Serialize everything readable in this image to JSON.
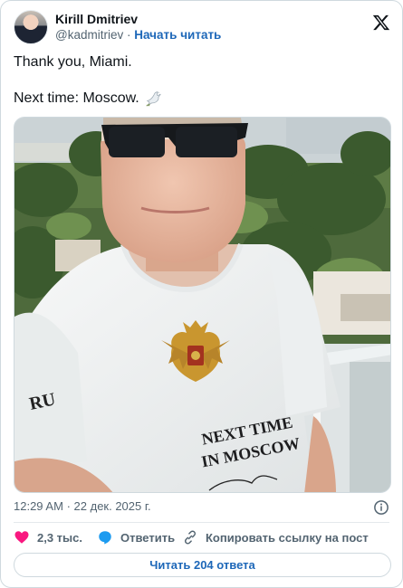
{
  "author": {
    "name": "Kirill Dmitriev",
    "handle": "@kadmitriev",
    "separator": "·",
    "follow_label": "Начать читать"
  },
  "tweet": {
    "line1": "Thank you, Miami.",
    "line2": "Next time: Moscow."
  },
  "photo": {
    "shirt_text_line1": "NEXT TIME",
    "shirt_text_line2": "IN MOSCOW",
    "sleeve_text": "RU"
  },
  "meta": {
    "time": "12:29 AM",
    "separator": "·",
    "date": "22 дек. 2025 г."
  },
  "actions": {
    "likes": "2,3 тыс.",
    "reply": "Ответить",
    "copy_link": "Копировать ссылку на пост"
  },
  "read_replies": "Читать 204 ответа",
  "colors": {
    "like": "#f91880",
    "reply": "#1d9bf0",
    "link": "#1d67b8",
    "secondary_text": "#536471"
  },
  "icons": [
    "x-logo-icon",
    "dove-icon",
    "info-icon",
    "heart-icon",
    "reply-bubble-icon",
    "link-icon"
  ]
}
